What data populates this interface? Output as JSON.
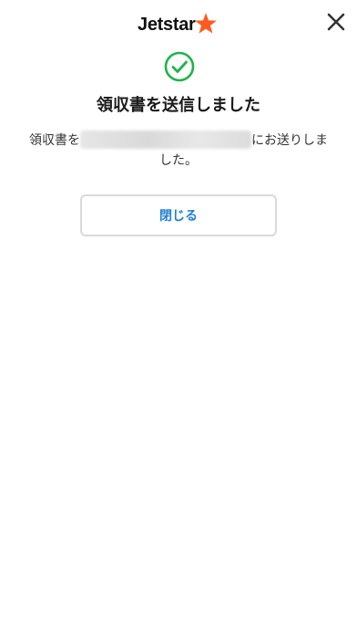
{
  "header": {
    "logo_text": "Jetstar",
    "logo_icon": "star-icon",
    "close_icon": "close-icon"
  },
  "status": {
    "icon": "check-circle-icon",
    "title": "領収書を送信しました",
    "message_prefix": "領収書を",
    "message_suffix": "にお送りしました。"
  },
  "actions": {
    "close_label": "閉じる"
  },
  "colors": {
    "brand_orange": "#ff5a1f",
    "success_green": "#1fb34a",
    "link_blue": "#1f7fd1",
    "border_gray": "#d9d9d9"
  }
}
